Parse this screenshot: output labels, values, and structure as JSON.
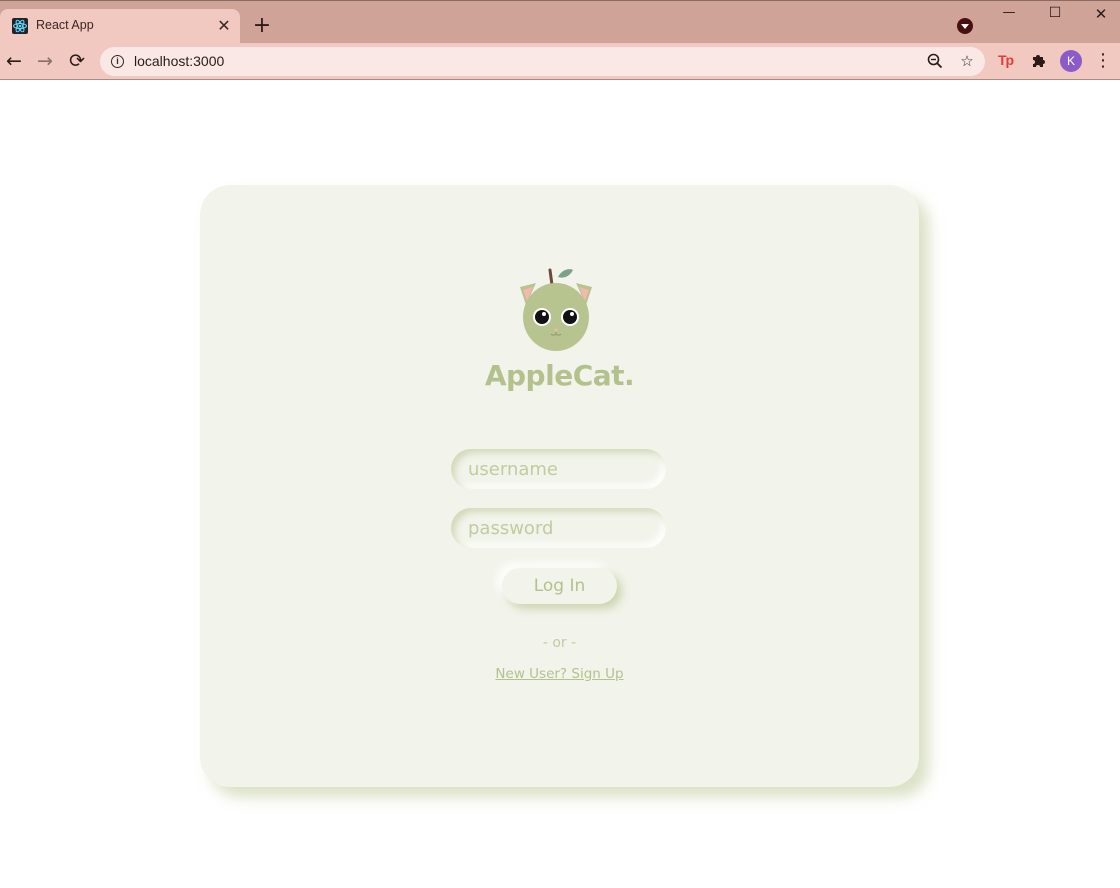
{
  "browser": {
    "tab": {
      "title": "React App",
      "favicon": "react-icon",
      "close_label": "✕"
    },
    "new_tab_label": "+",
    "window_controls": {
      "minimize": "—",
      "maximize": "☐",
      "close": "✕"
    },
    "nav": {
      "back": "←",
      "forward": "→",
      "reload": "⟳"
    },
    "address_bar": {
      "url": "localhost:3000",
      "info_icon": "i"
    },
    "address_icons": {
      "zoom": "zoom-icon",
      "bookmark": "☆"
    },
    "extensions": {
      "tp_label": "Tp",
      "puzzle": "puzzle-icon"
    },
    "avatar_letter": "K",
    "menu_label": "⋮",
    "colors": {
      "tabstrip": "#cfa398",
      "toolbar": "#f2c9c1",
      "avatar": "#8a5cc9"
    }
  },
  "login": {
    "brand": "AppleCat.",
    "username_placeholder": "username",
    "password_placeholder": "password",
    "login_label": "Log In",
    "or_text": "- or -",
    "signup_link": "New User? Sign Up",
    "colors": {
      "card": "#f2f4eb",
      "accent": "#b3c28c",
      "cat": "#b7c48f",
      "ears": "#f5b8ad"
    }
  }
}
